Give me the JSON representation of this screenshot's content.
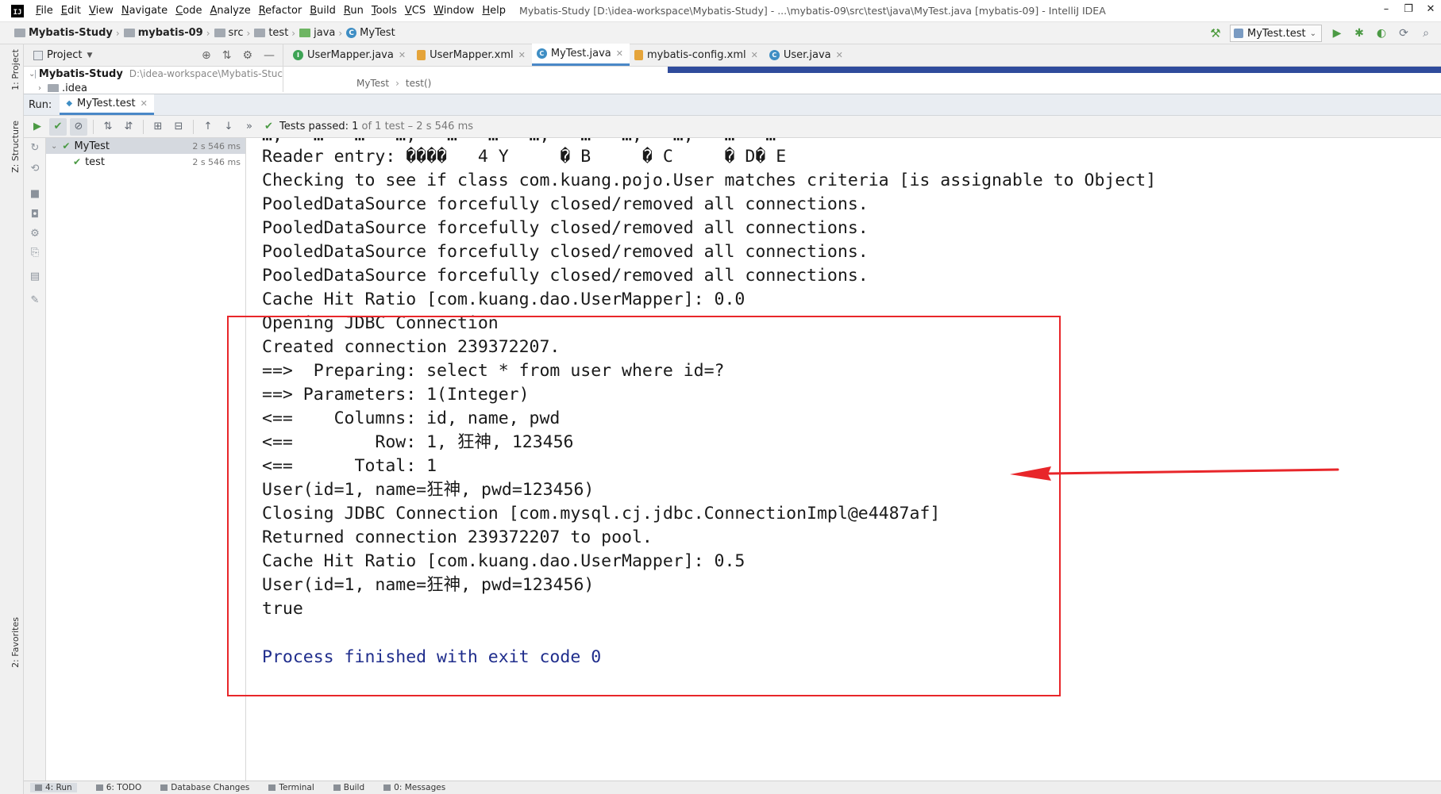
{
  "menu": {
    "items": [
      "File",
      "Edit",
      "View",
      "Navigate",
      "Code",
      "Analyze",
      "Refactor",
      "Build",
      "Run",
      "Tools",
      "VCS",
      "Window",
      "Help"
    ],
    "window_title": "Mybatis-Study [D:\\idea-workspace\\Mybatis-Study] - ...\\mybatis-09\\src\\test\\java\\MyTest.java [mybatis-09] - IntelliJ IDEA"
  },
  "navbar": {
    "crumbs": [
      "Mybatis-Study",
      "mybatis-09",
      "src",
      "test",
      "java",
      "MyTest"
    ],
    "run_config": "MyTest.test"
  },
  "project_panel": {
    "title": "Project",
    "root_name": "Mybatis-Study",
    "root_path": "D:\\idea-workspace\\Mybatis-Stuc",
    "child": ".idea"
  },
  "left_stripe": {
    "project_tab": "1: Project",
    "structure_tab": "Z: Structure",
    "favorites_tab": "2: Favorites"
  },
  "editor": {
    "tabs": [
      {
        "label": "UserMapper.java",
        "icon": "interface-icon"
      },
      {
        "label": "UserMapper.xml",
        "icon": "xml-icon"
      },
      {
        "label": "MyTest.java",
        "icon": "class-icon"
      },
      {
        "label": "mybatis-config.xml",
        "icon": "xml-icon"
      },
      {
        "label": "User.java",
        "icon": "class-icon"
      }
    ],
    "active_tab": "MyTest.java",
    "breadcrumb": [
      "MyTest",
      "test()"
    ]
  },
  "run_panel": {
    "label": "Run:",
    "tab": "MyTest.test",
    "status_prefix": "Tests passed:",
    "status_count": "1",
    "status_detail": "of 1 test – 2 s 546 ms",
    "tree": [
      {
        "name": "MyTest",
        "time": "2 s 546 ms"
      },
      {
        "name": "test",
        "time": "2 s 546 ms"
      }
    ]
  },
  "console": {
    "lines": [
      "Reader entry: ����   4 Y     � B     � C     � D� E",
      "Checking to see if class com.kuang.pojo.User matches criteria [is assignable to Object]",
      "PooledDataSource forcefully closed/removed all connections.",
      "PooledDataSource forcefully closed/removed all connections.",
      "PooledDataSource forcefully closed/removed all connections.",
      "PooledDataSource forcefully closed/removed all connections.",
      "Cache Hit Ratio [com.kuang.dao.UserMapper]: 0.0",
      "Opening JDBC Connection",
      "Created connection 239372207.",
      "==>  Preparing: select * from user where id=?",
      "==> Parameters: 1(Integer)",
      "<==    Columns: id, name, pwd",
      "<==        Row: 1, 狂神, 123456",
      "<==      Total: 1",
      "User(id=1, name=狂神, pwd=123456)",
      "Closing JDBC Connection [com.mysql.cj.jdbc.ConnectionImpl@e4487af]",
      "Returned connection 239372207 to pool.",
      "Cache Hit Ratio [com.kuang.dao.UserMapper]: 0.5",
      "User(id=1, name=狂神, pwd=123456)",
      "true"
    ],
    "exit_line": "Process finished with exit code 0"
  },
  "bottom_bar": {
    "tabs": [
      "4: Run",
      "6: TODO",
      "Database Changes",
      "Terminal",
      "Build",
      "0: Messages"
    ]
  },
  "colors": {
    "accent": "#4a88c7",
    "pass_green": "#4b9a44",
    "annotation_red": "#e8262a",
    "exit_blue": "#1f2d8c"
  }
}
